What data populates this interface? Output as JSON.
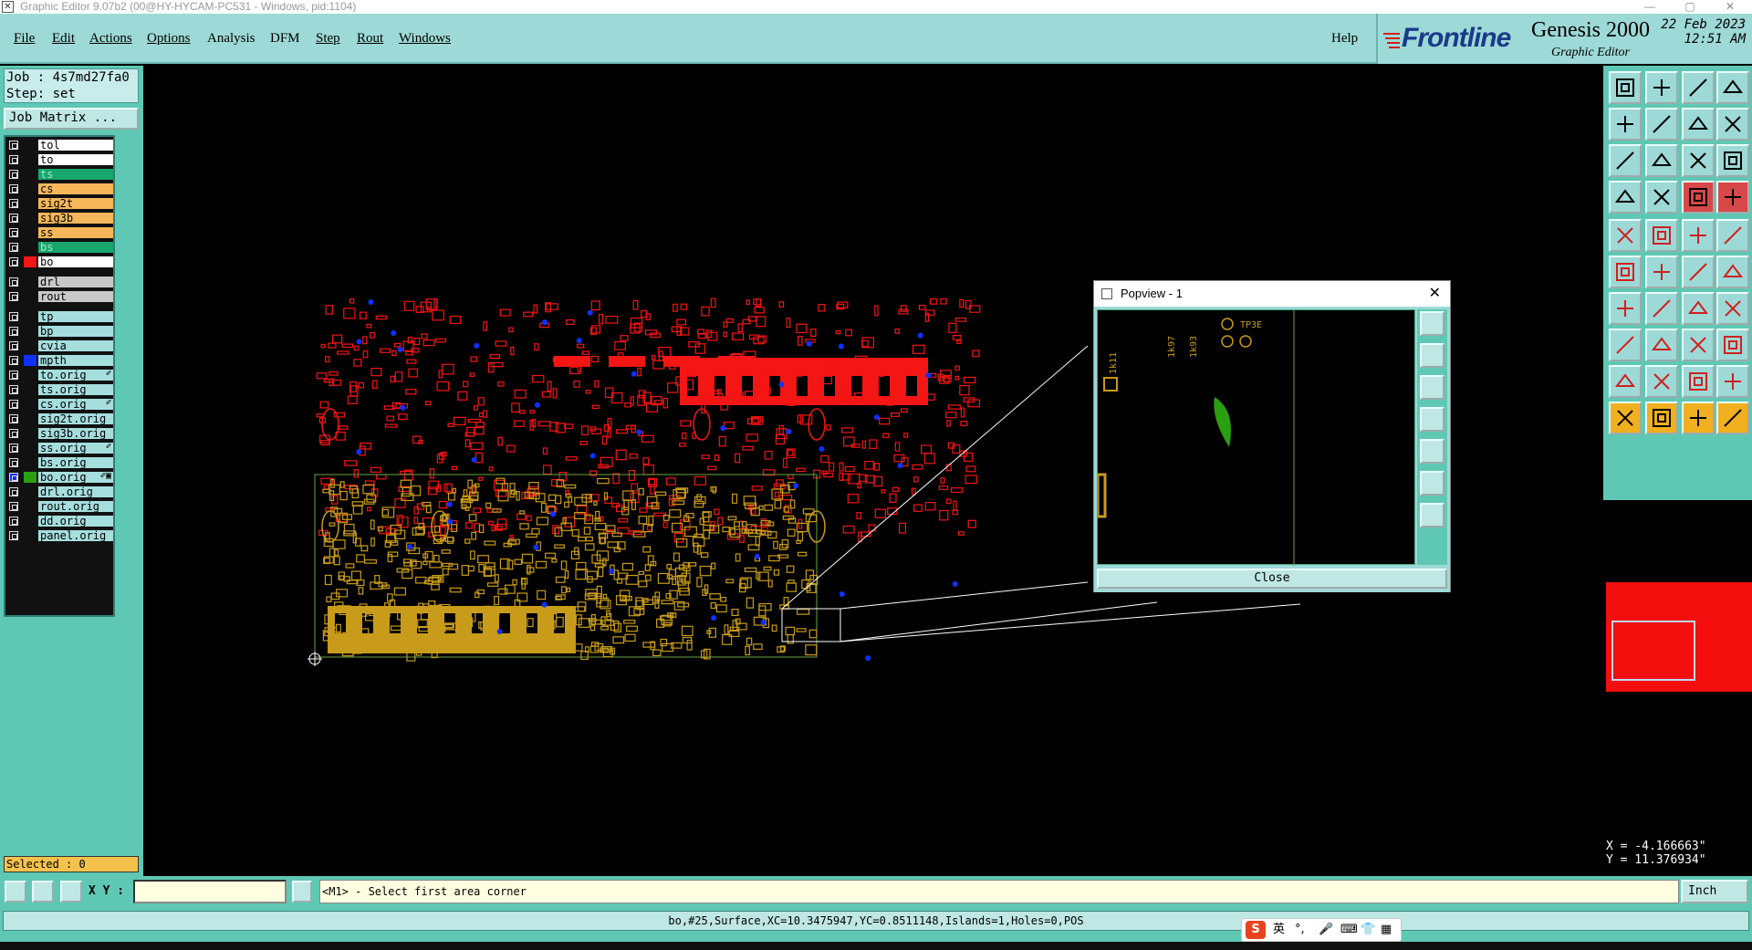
{
  "window": {
    "title": "Graphic Editor 9.07b2 (00@HY-HYCAM-PC531 - Windows, pid:1104)"
  },
  "menu": {
    "items": [
      "File",
      "Edit",
      "Actions",
      "Options",
      "Analysis",
      "DFM",
      "Step",
      "Rout",
      "Windows"
    ],
    "help": "Help"
  },
  "brand": {
    "logo": "Frontline",
    "product": "Genesis 2000",
    "module": "Graphic Editor",
    "date": "22 Feb 2023",
    "time": "12:51 AM"
  },
  "left": {
    "job": "Job : 4s7md27fa0",
    "step": "Step: set",
    "job_matrix": "Job Matrix ...",
    "selected": "Selected : 0"
  },
  "layers": [
    {
      "name": "tol",
      "color": "#ffffff",
      "style": "white",
      "swatch": "#111"
    },
    {
      "name": "to",
      "color": "#ffffff",
      "style": "white",
      "swatch": "#111"
    },
    {
      "name": "ts",
      "color": "#18a66e",
      "style": "green",
      "swatch": "#111"
    },
    {
      "name": "cs",
      "color": "#f6b75a",
      "style": "orange",
      "swatch": "#111"
    },
    {
      "name": "sig2t",
      "color": "#f6b75a",
      "style": "orange",
      "swatch": "#111"
    },
    {
      "name": "sig3b",
      "color": "#f6b75a",
      "style": "orange",
      "swatch": "#111"
    },
    {
      "name": "ss",
      "color": "#f6b75a",
      "style": "orange",
      "swatch": "#111"
    },
    {
      "name": "bs",
      "color": "#18a66e",
      "style": "green",
      "swatch": "#111"
    },
    {
      "name": "bo",
      "color": "#ffffff",
      "style": "white",
      "swatch": "#f41515"
    },
    {
      "name": "drl",
      "color": "#c8c8c8",
      "style": "gray",
      "swatch": "#111"
    },
    {
      "name": "rout",
      "color": "#c8c8c8",
      "style": "gray",
      "swatch": "#111"
    },
    {
      "name": "tp",
      "color": "#a6dede",
      "style": "cyan",
      "swatch": "#111"
    },
    {
      "name": "bp",
      "color": "#a6dede",
      "style": "cyan",
      "swatch": "#111"
    },
    {
      "name": "cvia",
      "color": "#a6dede",
      "style": "cyan",
      "swatch": "#111"
    },
    {
      "name": "mpth",
      "color": "#a6dede",
      "style": "cyan",
      "swatch": "#1030ff"
    },
    {
      "name": "to.orig",
      "color": "#a6dede",
      "style": "cyan",
      "swatch": "#111",
      "mark": "✐"
    },
    {
      "name": "ts.orig",
      "color": "#a6dede",
      "style": "cyan",
      "swatch": "#111"
    },
    {
      "name": "cs.orig",
      "color": "#a6dede",
      "style": "cyan",
      "swatch": "#111",
      "mark": "✐"
    },
    {
      "name": "sig2t.orig",
      "color": "#a6dede",
      "style": "cyan",
      "swatch": "#111"
    },
    {
      "name": "sig3b.orig",
      "color": "#a6dede",
      "style": "cyan",
      "swatch": "#111"
    },
    {
      "name": "ss.orig",
      "color": "#a6dede",
      "style": "cyan",
      "swatch": "#111",
      "mark": "✐"
    },
    {
      "name": "bs.orig",
      "color": "#a6dede",
      "style": "cyan",
      "swatch": "#111"
    },
    {
      "name": "bo.orig",
      "color": "#a6dede",
      "style": "cyan",
      "swatch": "#2aa010",
      "mark": "✐▣",
      "checked": true
    },
    {
      "name": "drl.orig",
      "color": "#a6dede",
      "style": "cyan",
      "swatch": "#111"
    },
    {
      "name": "rout.orig",
      "color": "#a6dede",
      "style": "cyan",
      "swatch": "#111"
    },
    {
      "name": "dd.orig",
      "color": "#a6dede",
      "style": "cyan",
      "swatch": "#111"
    },
    {
      "name": "panel.orig",
      "color": "#a6dede",
      "style": "cyan",
      "swatch": "#111"
    }
  ],
  "popview": {
    "title": "Popview - 1",
    "close_label": "Close",
    "labels": [
      "TP3E",
      "1k97",
      "1k93",
      "1k11"
    ]
  },
  "coords": {
    "x": "X = -4.166663\"",
    "y": "Y = 11.376934\""
  },
  "command": {
    "xy_label": "X Y :",
    "xy_value": "",
    "message": "<M1> - Select first area corner",
    "units": "Inch"
  },
  "status": "bo,#25,Surface,XC=10.3475947,YC=0.8511148,Islands=1,Holes=0,POS",
  "ime": {
    "lang": "英",
    "punct": "°,"
  },
  "colors": {
    "accent": "#9dd9d6",
    "panel": "#5fc8b4",
    "bottom_layer": "#f41515",
    "top_layer": "#c89b1a",
    "outline": "#6aa34a",
    "via": "#1030ff"
  }
}
